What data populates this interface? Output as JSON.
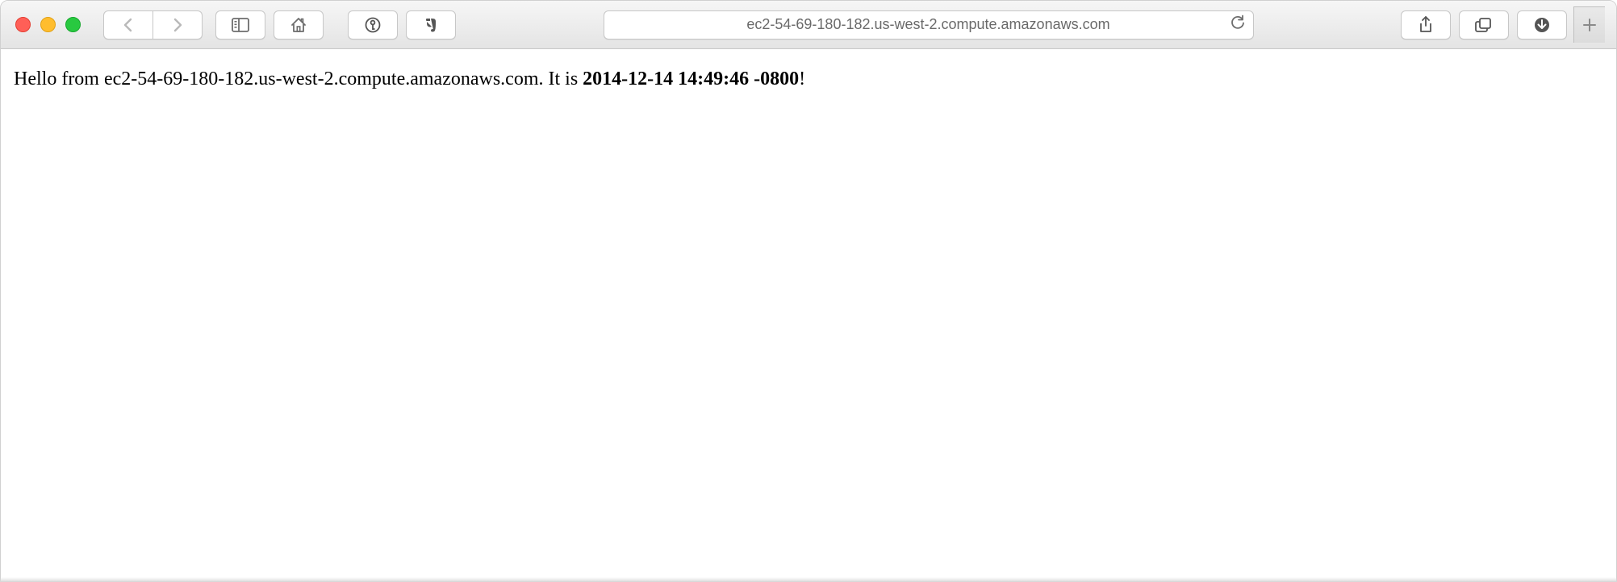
{
  "toolbar": {
    "url": "ec2-54-69-180-182.us-west-2.compute.amazonaws.com"
  },
  "page": {
    "greeting_prefix": "Hello from ",
    "hostname": "ec2-54-69-180-182.us-west-2.compute.amazonaws.com",
    "mid_text": ". It is ",
    "timestamp": "2014-12-14 14:49:46 -0800",
    "suffix": "!"
  }
}
